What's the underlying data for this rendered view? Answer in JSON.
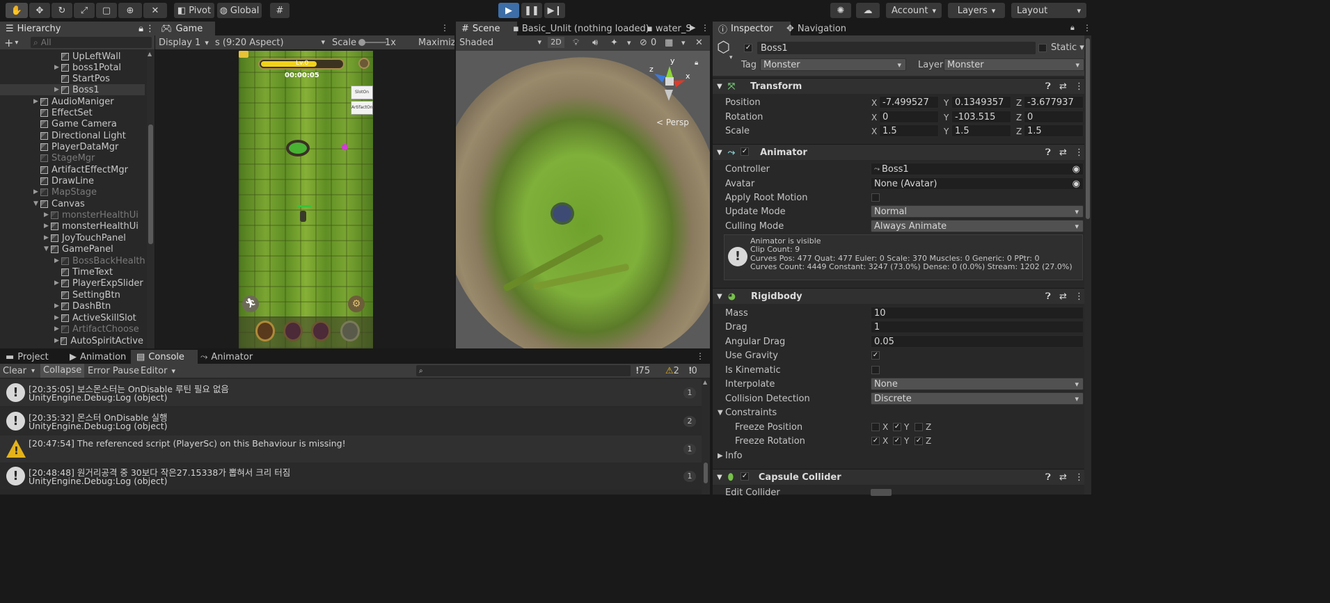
{
  "toolbar": {
    "pivot": "Pivot",
    "global": "Global",
    "account": "Account",
    "layers": "Layers",
    "layout": "Layout"
  },
  "hierarchy": {
    "tab": "Hierarchy",
    "search_placeholder": "All",
    "items": [
      {
        "label": "UpLeftWall"
      },
      {
        "label": "boss1Potal"
      },
      {
        "label": "StartPos"
      },
      {
        "label": "Boss1"
      },
      {
        "label": "AudioManiger"
      },
      {
        "label": "EffectSet"
      },
      {
        "label": "Game Camera"
      },
      {
        "label": "Directional Light"
      },
      {
        "label": "PlayerDataMgr"
      },
      {
        "label": "StageMgr"
      },
      {
        "label": "ArtifactEffectMgr"
      },
      {
        "label": "DrawLine"
      },
      {
        "label": "MapStage"
      },
      {
        "label": "Canvas"
      },
      {
        "label": "monsterHealthUi"
      },
      {
        "label": "monsterHealthUi"
      },
      {
        "label": "JoyTouchPanel"
      },
      {
        "label": "GamePanel"
      },
      {
        "label": "BossBackHealth"
      },
      {
        "label": "TimeText"
      },
      {
        "label": "PlayerExpSlider"
      },
      {
        "label": "SettingBtn"
      },
      {
        "label": "DashBtn"
      },
      {
        "label": "ActiveSkillSlot"
      },
      {
        "label": "ArtifactChoose"
      },
      {
        "label": "AutoSpiritActive"
      }
    ]
  },
  "game": {
    "tab": "Game",
    "display": "Display 1",
    "aspect": "s (9:20 Aspect)",
    "scale_label": "Scale",
    "scale_value": "1x",
    "maximize": "Maximize",
    "hud_level": "Lv.0",
    "hud_timer": "00:00:05",
    "slot_btn": "SlotOn",
    "artifact_btn": "ArtifactOn"
  },
  "scene": {
    "tab": "Scene",
    "tab2": "Basic_Unlit (nothing loaded)",
    "tab3": "water_S",
    "shading": "Shaded",
    "mode2d": "2D",
    "hidden_count": "0",
    "persp": "< Persp",
    "gizmo_y": "y",
    "gizmo_x": "x",
    "gizmo_z": "z"
  },
  "inspector": {
    "tab": "Inspector",
    "tab2": "Navigation",
    "object_name": "Boss1",
    "static": "Static",
    "tag_label": "Tag",
    "tag": "Monster",
    "layer_label": "Layer",
    "layer": "Monster",
    "transform": {
      "title": "Transform",
      "position_label": "Position",
      "position": {
        "x": "-7.499527",
        "y": "0.1349357",
        "z": "-3.677937"
      },
      "rotation_label": "Rotation",
      "rotation": {
        "x": "0",
        "y": "-103.515",
        "z": "0"
      },
      "scale_label": "Scale",
      "scale": {
        "x": "1.5",
        "y": "1.5",
        "z": "1.5"
      }
    },
    "animator": {
      "title": "Animator",
      "controller_label": "Controller",
      "controller": "Boss1",
      "avatar_label": "Avatar",
      "avatar": "None (Avatar)",
      "root_motion_label": "Apply Root Motion",
      "update_mode_label": "Update Mode",
      "update_mode": "Normal",
      "culling_label": "Culling Mode",
      "culling": "Always Animate",
      "info1": "Animator is visible",
      "info2": "Clip Count: 9",
      "info3": "Curves Pos: 477 Quat: 477 Euler: 0 Scale: 370 Muscles: 0 Generic: 0 PPtr: 0",
      "info4": "Curves Count: 4449 Constant: 3247 (73.0%) Dense: 0 (0.0%) Stream: 1202 (27.0%)"
    },
    "rigidbody": {
      "title": "Rigidbody",
      "mass_label": "Mass",
      "mass": "10",
      "drag_label": "Drag",
      "drag": "1",
      "angular_label": "Angular Drag",
      "angular": "0.05",
      "gravity_label": "Use Gravity",
      "kinematic_label": "Is Kinematic",
      "interpolate_label": "Interpolate",
      "interpolate": "None",
      "collision_label": "Collision Detection",
      "collision": "Discrete",
      "constraints_label": "Constraints",
      "freeze_pos_label": "Freeze Position",
      "freeze_rot_label": "Freeze Rotation",
      "info_label": "Info",
      "x": "X",
      "y": "Y",
      "z": "Z"
    },
    "capsule": {
      "title": "Capsule Collider",
      "edit_label": "Edit Collider"
    }
  },
  "bottom": {
    "tabs": [
      "Project",
      "Animation",
      "Console",
      "Animator"
    ],
    "clear": "Clear",
    "collapse": "Collapse",
    "error_pause": "Error Pause",
    "editor": "Editor",
    "count_log": "75",
    "count_warn": "2",
    "count_err": "0",
    "logs": [
      {
        "line1": "[20:35:05] 보스몬스터는 OnDisable 루틴 필요 없음",
        "line2": "UnityEngine.Debug:Log (object)",
        "count": "1",
        "kind": "info"
      },
      {
        "line1": "[20:35:32] 몬스터 OnDisable 실행",
        "line2": "UnityEngine.Debug:Log (object)",
        "count": "2",
        "kind": "info"
      },
      {
        "line1": "[20:47:54] The referenced script (PlayerSc) on this Behaviour is missing!",
        "line2": "",
        "count": "1",
        "kind": "warn"
      },
      {
        "line1": "[20:48:48] 원거리공격 중 30보다 작은27.15338가 뽑혀서 크리 터짐",
        "line2": "UnityEngine.Debug:Log (object)",
        "count": "1",
        "kind": "info"
      }
    ]
  },
  "colors": {
    "play_accent": "#3d6ea8",
    "warn": "#e4b31a",
    "grass": "#6f9c2a"
  }
}
